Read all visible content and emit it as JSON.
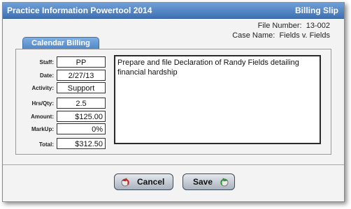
{
  "window": {
    "app_title": "Practice Information Powertool 2014",
    "dialog_title": "Billing Slip"
  },
  "file": {
    "number_label": "File Number:",
    "number_value": "13-002",
    "case_label": "Case Name:",
    "case_value": "Fields v. Fields"
  },
  "tab": {
    "label": "Calendar Billing"
  },
  "fields": {
    "staff": {
      "label": "Staff:",
      "value": "PP"
    },
    "date": {
      "label": "Date:",
      "value": "2/27/13"
    },
    "activity": {
      "label": "Activity:",
      "value": "Support"
    },
    "hrs_qty": {
      "label": "Hrs/Qty:",
      "value": "2.5"
    },
    "amount": {
      "label": "Amount:",
      "value": "$125.00"
    },
    "markup": {
      "label": "MarkUp:",
      "value": "0%"
    },
    "total": {
      "label": "Total:",
      "value": "$312.50"
    }
  },
  "notes": {
    "text": "Prepare and file Declaration of Randy Fields detailing financial hardship"
  },
  "buttons": {
    "cancel_label": "Cancel",
    "save_label": "Save"
  },
  "icons": {
    "cancel": "cancel-arrow-icon",
    "save": "save-arrow-icon"
  },
  "colors": {
    "titlebar": "#3f71b4",
    "tab": "#4f86c6"
  }
}
